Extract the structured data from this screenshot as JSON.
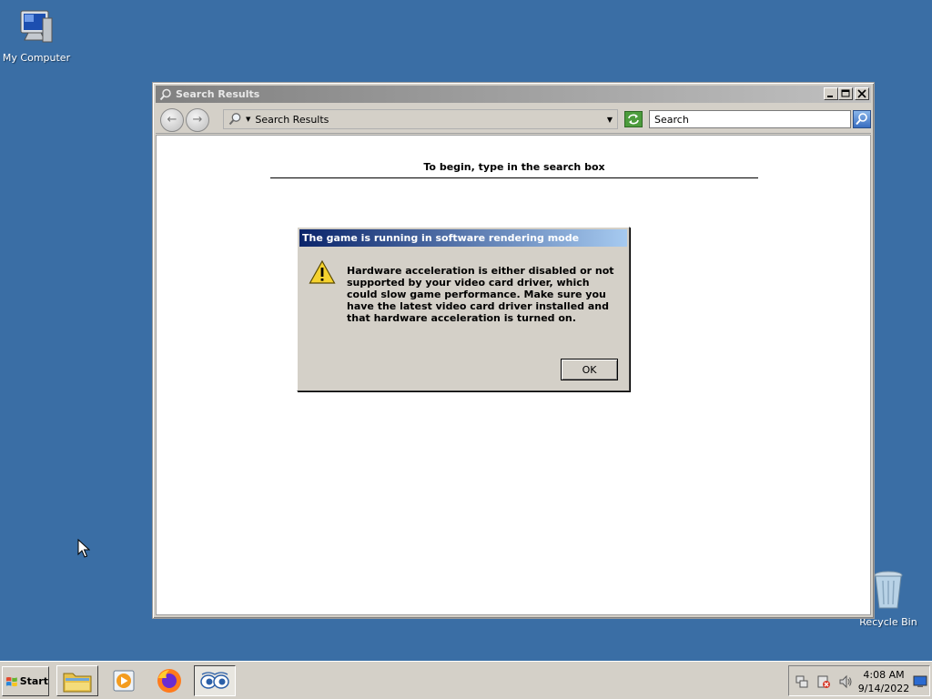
{
  "desktop": {
    "icons": [
      {
        "label": "My Computer",
        "icon": "computer-icon"
      },
      {
        "label": "Recycle Bin",
        "icon": "recycle-bin-icon"
      }
    ]
  },
  "explorer": {
    "title": "Search Results",
    "address_text": "Search Results",
    "search_value": "Search",
    "hint": "To begin, type in the search box"
  },
  "dialog": {
    "title": "The game is running in software rendering mode",
    "message": "Hardware acceleration is either disabled or not supported by your video card driver, which could slow game performance. Make sure you have the latest video card driver installed and that hardware acceleration is turned on.",
    "ok_label": "OK",
    "icon": "warning-icon"
  },
  "taskbar": {
    "start_label": "Start",
    "quick_launch": [
      "explorer-icon",
      "media-player-icon",
      "firefox-icon",
      "eyes-game-icon"
    ],
    "tray_icons": [
      "network-icon",
      "security-icon",
      "volume-icon",
      "display-icon"
    ],
    "clock_time": "4:08 AM",
    "clock_date": "9/14/2022"
  }
}
